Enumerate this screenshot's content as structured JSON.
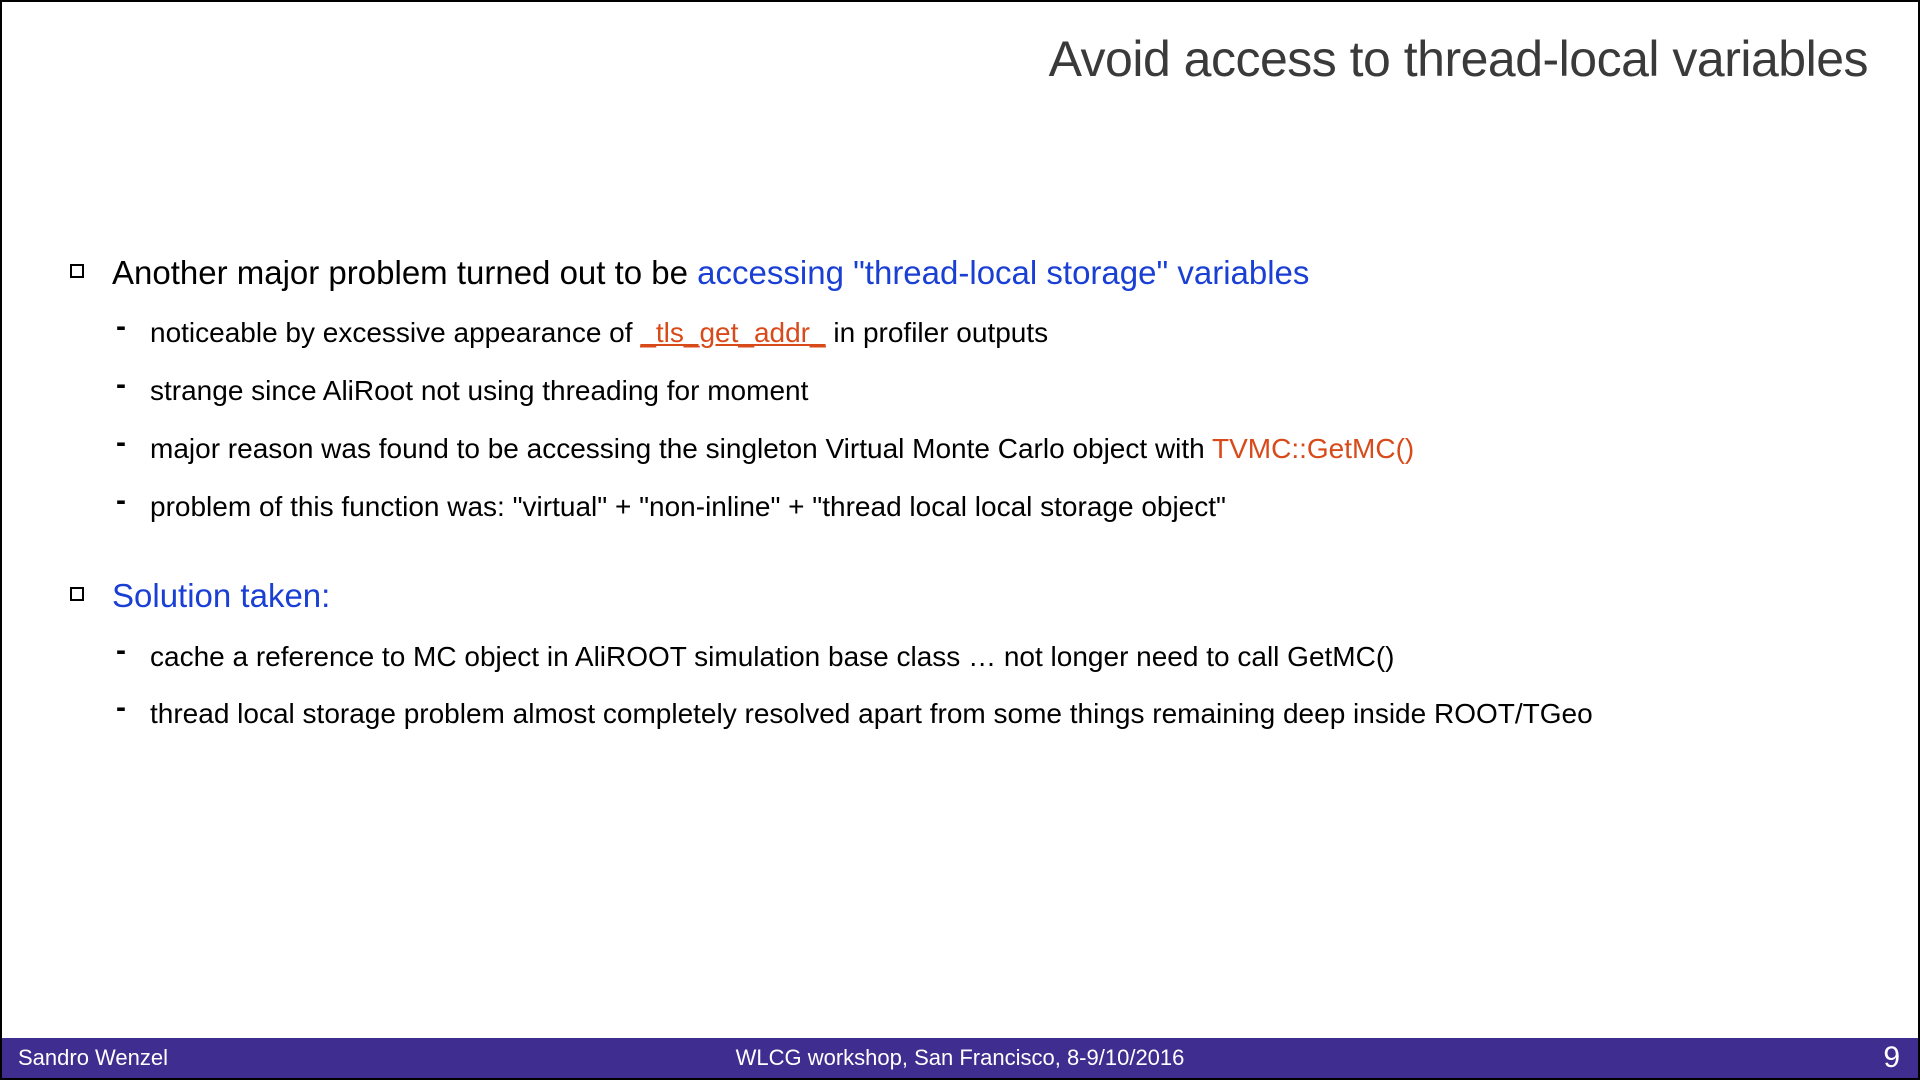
{
  "title": "Avoid access to thread-local variables",
  "sections": [
    {
      "main": {
        "prefix": "Another major problem turned out to be ",
        "highlight": "accessing \"thread-local storage\" variables"
      },
      "subs": [
        {
          "pre": "noticeable by excessive appearance of ",
          "orange": "_tls_get_addr_",
          "orangeClass": "underline",
          "post": " in profiler outputs"
        },
        {
          "pre": "strange since AliRoot not using threading for moment",
          "orange": "",
          "post": ""
        },
        {
          "pre": "major reason was found to be accessing the singleton Virtual Monte Carlo object with ",
          "orange": "TVMC::GetMC()",
          "post": ""
        },
        {
          "pre": "problem of this function was:  \"virtual\" + \"non-inline\" + \"thread local local storage object\"",
          "orange": "",
          "post": ""
        }
      ]
    },
    {
      "main": {
        "prefix": "",
        "highlight": "Solution taken:"
      },
      "subs": [
        {
          "pre": "cache a reference to MC object in AliROOT simulation base class … not longer need to call GetMC()",
          "orange": "",
          "post": ""
        },
        {
          "pre": "thread local storage problem almost completely resolved apart from some things remaining deep inside ROOT/TGeo",
          "orange": "",
          "post": ""
        }
      ]
    }
  ],
  "footer": {
    "author": "Sandro Wenzel",
    "event": "WLCG workshop,  San Francisco, 8-9/10/2016",
    "page": "9"
  }
}
